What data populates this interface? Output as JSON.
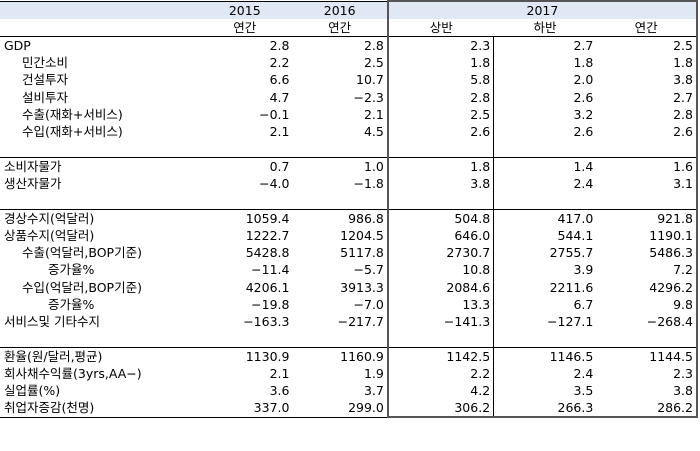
{
  "header": {
    "years": [
      "2015",
      "2016",
      "2017"
    ],
    "sub": [
      "연간",
      "연간",
      "상반",
      "하반",
      "연간"
    ]
  },
  "rows": [
    {
      "label": "GDP",
      "v": [
        "2.8",
        "2.8",
        "2.3",
        "2.7",
        "2.5"
      ]
    },
    {
      "label": "민간소비",
      "v": [
        "2.2",
        "2.5",
        "1.8",
        "1.8",
        "1.8"
      ]
    },
    {
      "label": "건설투자",
      "v": [
        "6.6",
        "10.7",
        "5.8",
        "2.0",
        "3.8"
      ]
    },
    {
      "label": "설비투자",
      "v": [
        "4.7",
        "−2.3",
        "2.8",
        "2.6",
        "2.7"
      ]
    },
    {
      "label": "수출(재화+서비스)",
      "v": [
        "−0.1",
        "2.1",
        "2.5",
        "3.2",
        "2.8"
      ]
    },
    {
      "label": "수입(재화+서비스)",
      "v": [
        "2.1",
        "4.5",
        "2.6",
        "2.6",
        "2.6"
      ]
    },
    {
      "label": "",
      "v": [
        "",
        "",
        "",
        "",
        ""
      ]
    },
    {
      "label": "소비자물가",
      "v": [
        "0.7",
        "1.0",
        "1.8",
        "1.4",
        "1.6"
      ]
    },
    {
      "label": "생산자물가",
      "v": [
        "−4.0",
        "−1.8",
        "3.8",
        "2.4",
        "3.1"
      ]
    },
    {
      "label": "",
      "v": [
        "",
        "",
        "",
        "",
        ""
      ]
    },
    {
      "label": "경상수지(억달러)",
      "v": [
        "1059.4",
        "986.8",
        "504.8",
        "417.0",
        "921.8"
      ]
    },
    {
      "label": "상품수지(억달러)",
      "v": [
        "1222.7",
        "1204.5",
        "646.0",
        "544.1",
        "1190.1"
      ]
    },
    {
      "label": "수출(억달러,BOP기준)",
      "v": [
        "5428.8",
        "5117.8",
        "2730.7",
        "2755.7",
        "5486.3"
      ]
    },
    {
      "label": "증가율%",
      "v": [
        "−11.4",
        "−5.7",
        "10.8",
        "3.9",
        "7.2"
      ]
    },
    {
      "label": "수입(억달러,BOP기준)",
      "v": [
        "4206.1",
        "3913.3",
        "2084.6",
        "2211.6",
        "4296.2"
      ]
    },
    {
      "label": "증가율%",
      "v": [
        "−19.8",
        "−7.0",
        "13.3",
        "6.7",
        "9.8"
      ]
    },
    {
      "label": "서비스및  기타수지",
      "v": [
        "−163.3",
        "−217.7",
        "−141.3",
        "−127.1",
        "−268.4"
      ]
    },
    {
      "label": "",
      "v": [
        "",
        "",
        "",
        "",
        ""
      ]
    },
    {
      "label": "환율(원/달러,평균)",
      "v": [
        "1130.9",
        "1160.9",
        "1142.5",
        "1146.5",
        "1144.5"
      ]
    },
    {
      "label": "회사채수익률(3yrs,AA−)",
      "v": [
        "2.1",
        "1.9",
        "2.2",
        "2.4",
        "2.3"
      ]
    },
    {
      "label": "실업률(%)",
      "v": [
        "3.6",
        "3.7",
        "4.2",
        "3.5",
        "3.8"
      ]
    },
    {
      "label": "취업자증감(천명)",
      "v": [
        "337.0",
        "299.0",
        "306.2",
        "266.3",
        "286.2"
      ]
    }
  ]
}
